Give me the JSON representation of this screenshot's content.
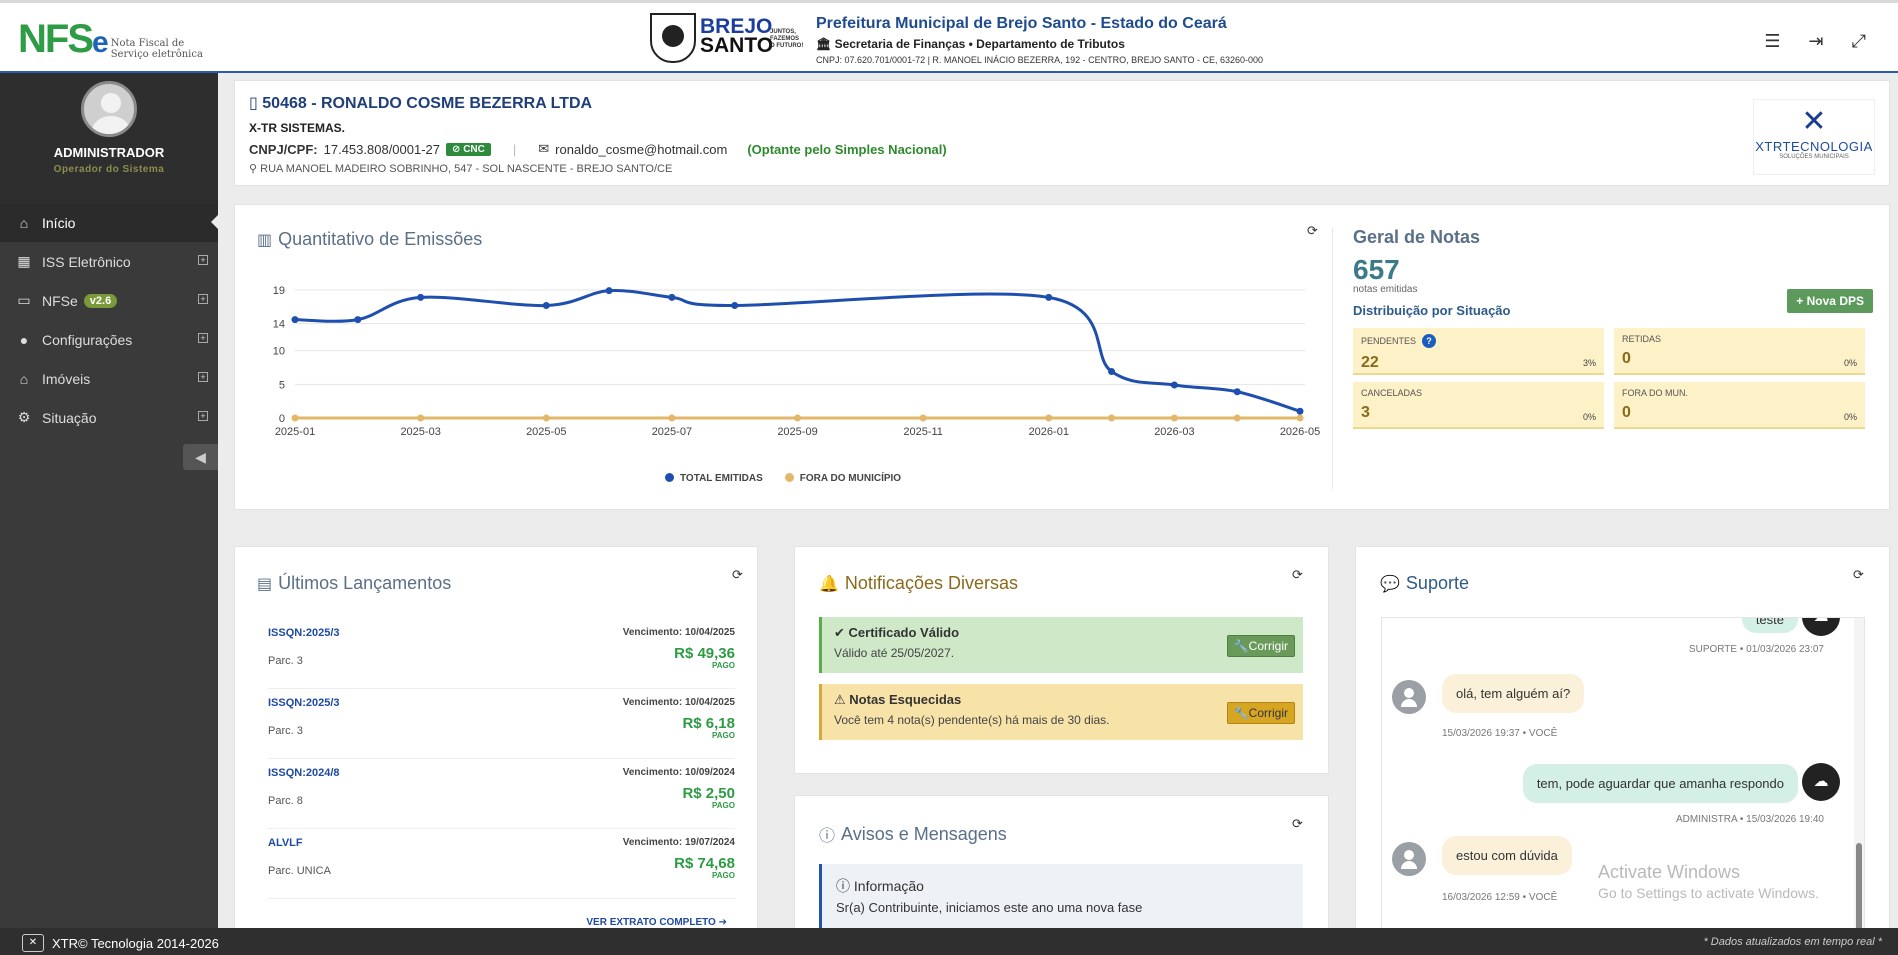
{
  "header": {
    "logo_nfs": "NFS",
    "logo_e": "e",
    "logo_sub1": "Nota Fiscal de",
    "logo_sub2": "Serviço eletrônica",
    "brejo1": "BREJO",
    "brejo2": "SANTO",
    "brejo_tag1": "JUNTOS,",
    "brejo_tag2": "FAZEMOS",
    "brejo_tag3": "O FUTURO!",
    "title": "Prefeitura Municipal de Brejo Santo - Estado do Ceará",
    "secretaria": "Secretaria de Finanças • Departamento de Tributos",
    "cnpj_line": "CNPJ: 07.620.701/0001-72 | R. MANOEL INÁCIO BEZERRA, 192 - CENTRO, BREJO SANTO - CE, 63260-000"
  },
  "sidebar": {
    "user_name": "ADMINISTRADOR",
    "user_role": "Operador do Sistema",
    "items": [
      {
        "label": "Início",
        "icon": "home-icon"
      },
      {
        "label": "ISS Eletrônico",
        "icon": "table-icon"
      },
      {
        "label": "NFSe",
        "icon": "inbox-icon",
        "badge": "v2.6"
      },
      {
        "label": "Configurações",
        "icon": "user-icon"
      },
      {
        "label": "Imóveis",
        "icon": "home-icon"
      },
      {
        "label": "Situação",
        "icon": "gear-icon"
      }
    ]
  },
  "company": {
    "title": "50468 - RONALDO COSME BEZERRA LTDA",
    "subtitle": "X-TR SISTEMAS.",
    "cnpj_label": "CNPJ/CPF:",
    "cnpj": "17.453.808/0001-27",
    "cnc": "CNC",
    "email": "ronaldo_cosme@hotmail.com",
    "simples": "(Optante pelo Simples Nacional)",
    "address": "RUA MANOEL MADEIRO SOBRINHO, 547 - SOL NASCENTE - BREJO SANTO/CE",
    "xtr_text": "XTRTECNOLOGIA",
    "xtr_sub": "SOLUÇÕES MUNICIPAIS"
  },
  "emissoes": {
    "title": "Quantitativo de Emissões"
  },
  "chart_data": {
    "type": "line",
    "title": "Quantitativo de Emissões",
    "x": [
      "2025-01",
      "2025-02",
      "2025-03",
      "2025-04",
      "2025-05",
      "2025-06",
      "2025-07",
      "2025-08",
      "2025-09",
      "2025-10",
      "2025-11",
      "2025-12",
      "2026-01",
      "2026-02",
      "2026-03",
      "2026-04",
      "2026-05"
    ],
    "xticks": [
      "2025-01",
      "2025-03",
      "2025-05",
      "2025-07",
      "2025-09",
      "2025-11",
      "2026-01",
      "2026-03",
      "2026-05"
    ],
    "yticks": [
      0,
      5,
      10,
      14,
      19
    ],
    "ylim": [
      0,
      19
    ],
    "series": [
      {
        "name": "TOTAL EMITIDAS",
        "color": "#1f4fae",
        "values": [
          14.6,
          14.6,
          17.9,
          null,
          16.7,
          18.9,
          17.9,
          16.7,
          null,
          null,
          null,
          null,
          17.9,
          6.9,
          4.9,
          3.9,
          1.0
        ]
      },
      {
        "name": "FORA DO MUNICÍPIO",
        "color": "#e3b76a",
        "values": [
          0,
          0,
          0,
          0,
          0,
          0,
          0,
          0,
          0,
          0,
          0,
          0,
          0,
          0,
          0,
          0,
          0
        ]
      }
    ],
    "legend": "bottom"
  },
  "geral": {
    "title": "Geral de Notas",
    "count": "657",
    "count_sub": "notas emitidas",
    "nova_dps": "Nova DPS",
    "distrib": "Distribuição por Situação",
    "stats": [
      {
        "label": "PENDENTES",
        "value": "22",
        "pct": "3%"
      },
      {
        "label": "RETIDAS",
        "value": "0",
        "pct": "0%"
      },
      {
        "label": "CANCELADAS",
        "value": "3",
        "pct": "0%"
      },
      {
        "label": "FORA DO MUN.",
        "value": "0",
        "pct": "0%"
      }
    ]
  },
  "lancamentos": {
    "title": "Últimos Lançamentos",
    "items": [
      {
        "code": "ISSQN:2025/3",
        "parc": "Parc. 3",
        "venc": "Vencimento: 10/04/2025",
        "valor": "R$ 49,36",
        "status": "PAGO"
      },
      {
        "code": "ISSQN:2025/3",
        "parc": "Parc. 3",
        "venc": "Vencimento: 10/04/2025",
        "valor": "R$ 6,18",
        "status": "PAGO"
      },
      {
        "code": "ISSQN:2024/8",
        "parc": "Parc. 8",
        "venc": "Vencimento: 10/09/2024",
        "valor": "R$ 2,50",
        "status": "PAGO"
      },
      {
        "code": "ALVLF",
        "parc": "Parc. UNICA",
        "venc": "Vencimento: 19/07/2024",
        "valor": "R$ 74,68",
        "status": "PAGO"
      }
    ],
    "ver_extrato": "VER EXTRATO COMPLETO"
  },
  "notificacoes": {
    "title": "Notificações Diversas",
    "cert_title": "Certificado Válido",
    "cert_text": "Válido até 25/05/2027.",
    "esq_title": "Notas Esquecidas",
    "esq_text": "Você tem 4 nota(s) pendente(s) há mais de 30 dias.",
    "corrigir": "Corrigir"
  },
  "avisos": {
    "title": "Avisos e Mensagens",
    "info_title": "Informação",
    "info_text": "Sr(a) Contribuinte, iniciamos este ano uma nova fase"
  },
  "suporte": {
    "title": "Suporte",
    "msgs": [
      {
        "text": "teste",
        "meta": "SUPORTE • 01/03/2026 23:07"
      },
      {
        "text": "olá, tem alguém aí?",
        "meta": "15/03/2026 19:37 • VOCÊ"
      },
      {
        "text": "tem, pode aguardar que amanha respondo",
        "meta": "ADMINISTRA • 15/03/2026 19:40"
      },
      {
        "text": "estou com dúvida",
        "meta": "16/03/2026 12:59 • VOCÊ"
      }
    ]
  },
  "footer": {
    "left": "XTR© Tecnologia 2014-2026",
    "right": "* Dados atualizados em tempo real *"
  },
  "watermark": {
    "line1": "Activate Windows",
    "line2": "Go to Settings to activate Windows."
  }
}
